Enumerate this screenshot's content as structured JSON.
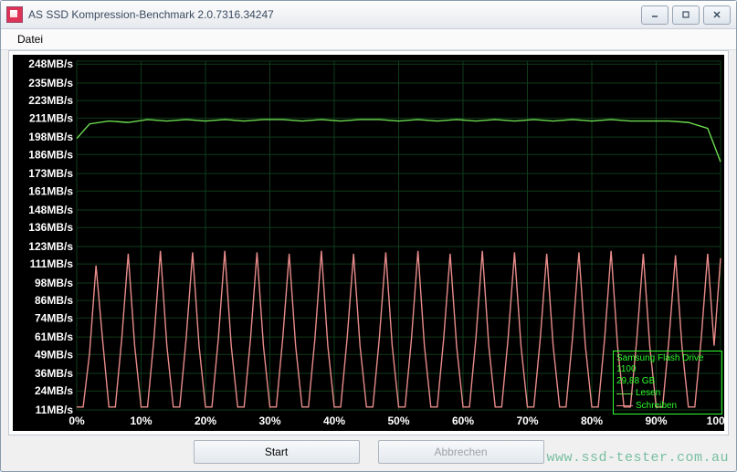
{
  "window": {
    "title": "AS SSD Kompression-Benchmark 2.0.7316.34247"
  },
  "menu": {
    "file": "Datei"
  },
  "chart_data": {
    "type": "line",
    "xlabel": "",
    "ylabel": "",
    "x_unit": "%",
    "y_unit": "MB/s",
    "xlim": [
      0,
      100
    ],
    "ylim": [
      11,
      250
    ],
    "y_ticks": [
      11,
      24,
      36,
      49,
      61,
      74,
      86,
      98,
      111,
      123,
      136,
      148,
      161,
      173,
      186,
      198,
      211,
      223,
      235,
      248
    ],
    "x_ticks": [
      0,
      10,
      20,
      30,
      40,
      50,
      60,
      70,
      80,
      90,
      100
    ],
    "series": [
      {
        "name": "Lesen",
        "color": "#6cdc50",
        "x": [
          0,
          2,
          5,
          8,
          11,
          14,
          17,
          20,
          23,
          26,
          29,
          32,
          35,
          38,
          41,
          44,
          47,
          50,
          53,
          56,
          59,
          62,
          65,
          68,
          71,
          74,
          77,
          80,
          83,
          86,
          89,
          92,
          95,
          98,
          100
        ],
        "y": [
          197,
          207,
          209,
          208,
          210,
          209,
          210,
          209,
          210,
          209,
          210,
          210,
          209,
          210,
          209,
          210,
          210,
          209,
          210,
          209,
          210,
          209,
          210,
          209,
          210,
          209,
          210,
          209,
          210,
          209,
          209,
          209,
          208,
          204,
          181
        ]
      },
      {
        "name": "Schreiben",
        "color": "#e98b8b",
        "x": [
          0,
          1,
          2,
          3,
          4,
          5,
          6,
          7,
          8,
          9,
          10,
          11,
          12,
          13,
          14,
          15,
          16,
          17,
          18,
          19,
          20,
          21,
          22,
          23,
          24,
          25,
          26,
          27,
          28,
          29,
          30,
          31,
          32,
          33,
          34,
          35,
          36,
          37,
          38,
          39,
          40,
          41,
          42,
          43,
          44,
          45,
          46,
          47,
          48,
          49,
          50,
          51,
          52,
          53,
          54,
          55,
          56,
          57,
          58,
          59,
          60,
          61,
          62,
          63,
          64,
          65,
          66,
          67,
          68,
          69,
          70,
          71,
          72,
          73,
          74,
          75,
          76,
          77,
          78,
          79,
          80,
          81,
          82,
          83,
          84,
          85,
          86,
          87,
          88,
          89,
          90,
          91,
          92,
          93,
          94,
          95,
          96,
          97,
          98,
          99,
          100
        ],
        "y": [
          13,
          13,
          50,
          110,
          60,
          13,
          13,
          60,
          118,
          55,
          13,
          13,
          60,
          120,
          55,
          13,
          13,
          60,
          119,
          55,
          13,
          13,
          60,
          120,
          55,
          13,
          13,
          60,
          119,
          55,
          13,
          13,
          60,
          118,
          55,
          13,
          13,
          60,
          120,
          55,
          13,
          13,
          60,
          118,
          55,
          13,
          13,
          60,
          119,
          55,
          13,
          13,
          60,
          120,
          55,
          13,
          13,
          60,
          118,
          55,
          13,
          13,
          60,
          120,
          55,
          13,
          13,
          60,
          119,
          55,
          13,
          13,
          60,
          118,
          55,
          13,
          13,
          60,
          119,
          55,
          13,
          13,
          60,
          120,
          55,
          13,
          13,
          60,
          118,
          55,
          13,
          13,
          60,
          117,
          55,
          13,
          13,
          60,
          118,
          55,
          115
        ]
      }
    ]
  },
  "legend": {
    "device": "Samsung Flash Drive 1100",
    "capacity": "29,88 GB",
    "read": "Lesen",
    "write": "Schreiben"
  },
  "buttons": {
    "start": "Start",
    "abort": "Abbrechen"
  },
  "watermark": "www.ssd-tester.com.au"
}
